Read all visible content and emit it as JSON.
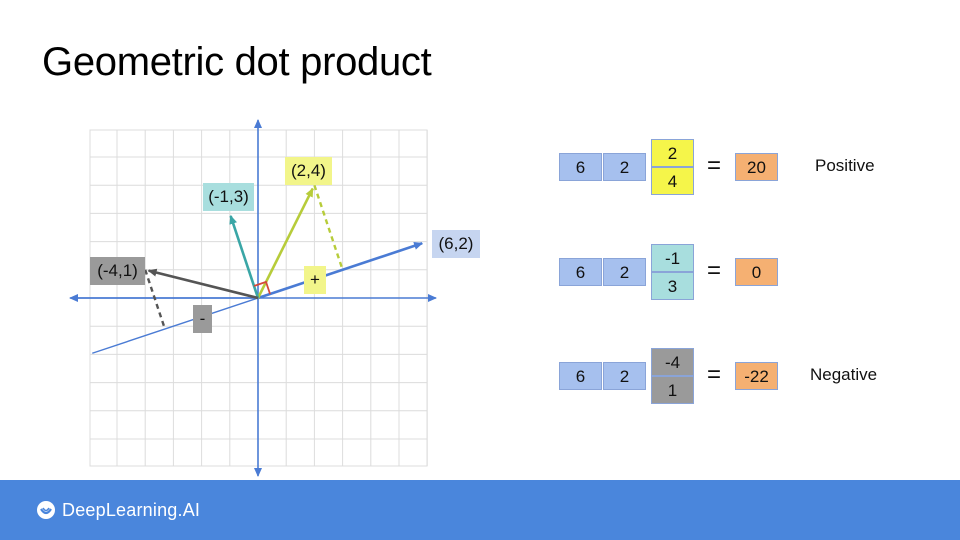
{
  "slide": {
    "title": "Geometric dot product"
  },
  "diagram": {
    "base_vector": {
      "label": "(6,2)",
      "x": 6,
      "y": 2,
      "color": "#4a7bd4",
      "label_bg": "#c6d5f0"
    },
    "vectors": [
      {
        "id": "v1",
        "label": "(2,4)",
        "x": 2,
        "y": 4,
        "color": "#b7cc3a",
        "label_bg": "#f2f58a",
        "projection_sign": "+",
        "sign_bg": "#f2f58a"
      },
      {
        "id": "v2",
        "label": "(-1,3)",
        "x": -1,
        "y": 3,
        "color": "#3aa6a6",
        "label_bg": "#a8dede"
      },
      {
        "id": "v3",
        "label": "(-4,1)",
        "x": -4,
        "y": 1,
        "color": "#555555",
        "label_bg": "#9a9a9a",
        "projection_sign": "-",
        "sign_bg": "#9a9a9a"
      }
    ],
    "grid": true
  },
  "equations": [
    {
      "row": [
        6,
        2
      ],
      "col": [
        2,
        4
      ],
      "result": 20,
      "note": "Positive",
      "col_bg": "#f5f54a"
    },
    {
      "row": [
        6,
        2
      ],
      "col": [
        -1,
        3
      ],
      "result": 0,
      "note": "",
      "col_bg": "#a8dede"
    },
    {
      "row": [
        6,
        2
      ],
      "col": [
        -4,
        1
      ],
      "result": -22,
      "note": "Negative",
      "col_bg": "#9a9a9a"
    }
  ],
  "equals_sign": "=",
  "colors": {
    "row_bg": "#a6c0ee",
    "result_bg": "#f5b072",
    "footer_bg": "#4a86dc",
    "axis": "#4a7bd4"
  },
  "footer": {
    "brand": "DeepLearning.AI",
    "brand_icon": "deeplearning-logo-icon"
  }
}
